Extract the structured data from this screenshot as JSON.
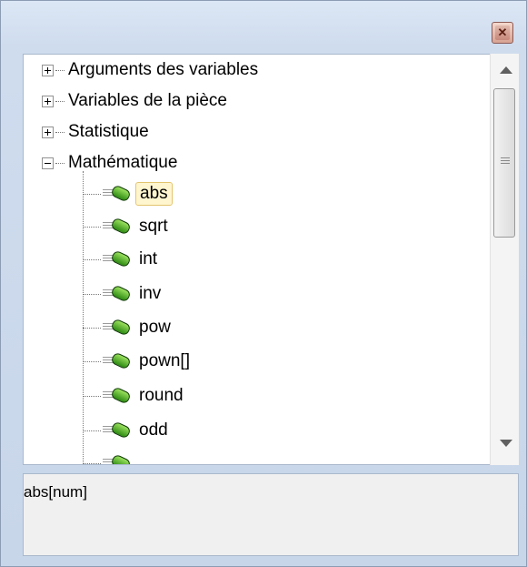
{
  "window": {
    "close_glyph": "✕"
  },
  "tree": {
    "categories": [
      {
        "label": "Arguments des variables",
        "state": "collapsed"
      },
      {
        "label": "Variables de la pièce",
        "state": "collapsed"
      },
      {
        "label": "Statistique",
        "state": "collapsed"
      },
      {
        "label": "Mathématique",
        "state": "expanded"
      }
    ],
    "functions": [
      {
        "label": "abs",
        "selected": true
      },
      {
        "label": "sqrt"
      },
      {
        "label": "int"
      },
      {
        "label": "inv"
      },
      {
        "label": "pow"
      },
      {
        "label": "pown[]"
      },
      {
        "label": "round"
      },
      {
        "label": "odd"
      }
    ],
    "function_icon": "function-icon"
  },
  "description": {
    "text": "abs[num]"
  }
}
